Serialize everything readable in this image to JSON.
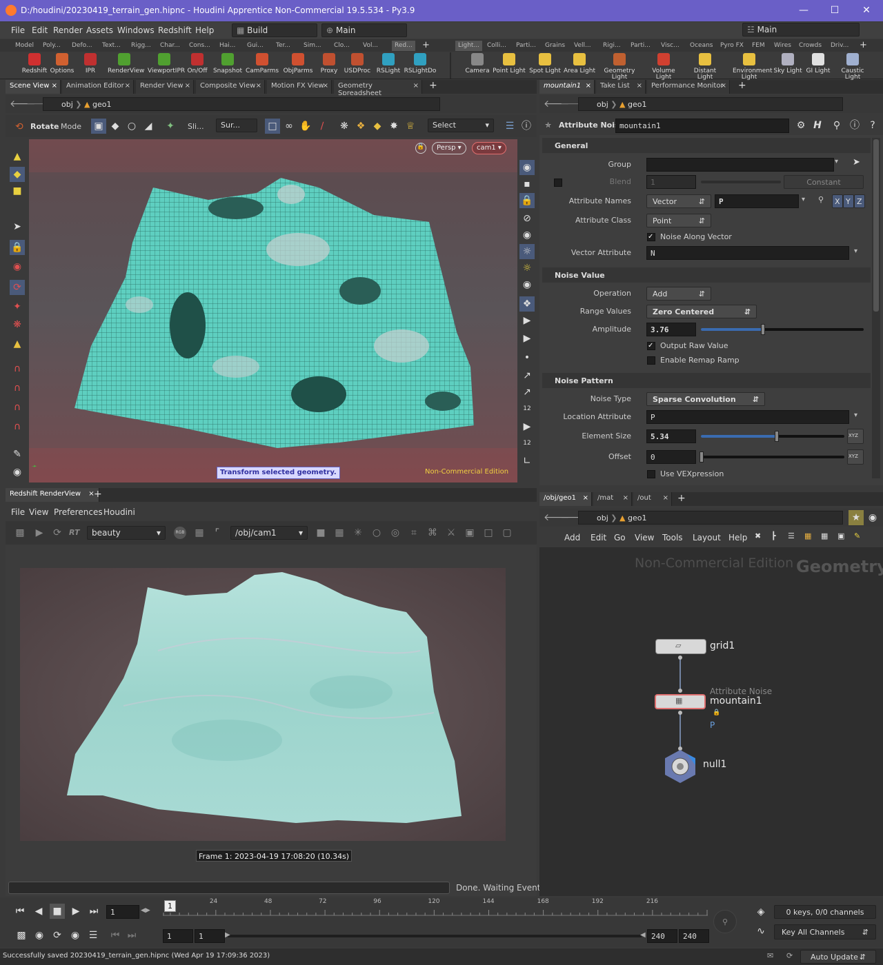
{
  "window": {
    "title": "D:/houdini/20230419_terrain_gen.hipnc - Houdini Apprentice Non-Commercial 19.5.534 - Py3.9",
    "minimize": "—",
    "maximize": "☐",
    "close": "✕"
  },
  "menu": {
    "items": [
      "File",
      "Edit",
      "Render",
      "Assets",
      "Windows",
      "Redshift",
      "Help"
    ],
    "desktop": "Build",
    "network": "Main",
    "right_combo": "Main"
  },
  "shelf_tabs_left": [
    "Model",
    "Poly...",
    "Defo...",
    "Text...",
    "Rigg...",
    "Char...",
    "Cons...",
    "Hai...",
    "Gui...",
    "Ter...",
    "Sim...",
    "Clo...",
    "Vol...",
    "Red..."
  ],
  "shelf_tabs_right": [
    "Light...",
    "Colli...",
    "Parti...",
    "Grains",
    "Vell...",
    "Rigi...",
    "Parti...",
    "Visc...",
    "Oceans",
    "Pyro FX",
    "FEM",
    "Wires",
    "Crowds",
    "Driv..."
  ],
  "tools_left": [
    {
      "label": "Redshift",
      "color": "#d03030"
    },
    {
      "label": "Options",
      "color": "#d06030"
    },
    {
      "label": "IPR",
      "color": "#c03030"
    },
    {
      "label": "RenderView",
      "color": "#50a030"
    },
    {
      "label": "ViewportIPR",
      "color": "#50a030"
    },
    {
      "label": "On/Off",
      "color": "#c03030"
    },
    {
      "label": "Snapshot",
      "color": "#50a030"
    },
    {
      "label": "CamParms",
      "color": "#d05030"
    },
    {
      "label": "ObjParms",
      "color": "#d05030"
    },
    {
      "label": "Proxy",
      "color": "#c05030"
    },
    {
      "label": "USDProc",
      "color": "#c05030"
    },
    {
      "label": "RSLight",
      "color": "#30a0c0"
    },
    {
      "label": "RSLightDo",
      "color": "#30a0c0"
    }
  ],
  "tools_right": [
    {
      "label": "Camera",
      "color": "#888888"
    },
    {
      "label": "Point Light",
      "color": "#e8c040"
    },
    {
      "label": "Spot Light",
      "color": "#e8c040"
    },
    {
      "label": "Area Light",
      "color": "#e8c040"
    },
    {
      "label": "Geometry Light",
      "color": "#c06030"
    },
    {
      "label": "Volume Light",
      "color": "#d04030"
    },
    {
      "label": "Distant Light",
      "color": "#e8c040"
    },
    {
      "label": "Environment Light",
      "color": "#e8c040"
    },
    {
      "label": "Sky Light",
      "color": "#b0b0c0"
    },
    {
      "label": "GI Light",
      "color": "#e0e0e0"
    },
    {
      "label": "Caustic Light",
      "color": "#a0b0d0"
    }
  ],
  "left_tabs": [
    "Scene View",
    "Animation Editor",
    "Render View",
    "Composite View",
    "Motion FX View",
    "Geometry Spreadsheet"
  ],
  "right_tabs": [
    "mountain1",
    "Take List",
    "Performance Monitor"
  ],
  "scene_path": {
    "obj": "obj",
    "geo": "geo1"
  },
  "scene_toolbar": {
    "rotate": "Rotate",
    "mode": "Mode",
    "sli": "Sli...",
    "sur": "Sur...",
    "select": "Select"
  },
  "viewport": {
    "persp": "Persp ▾",
    "cam": "cam1 ▾",
    "status": "Transform selected geometry.",
    "edition": "Non-Commercial Edition"
  },
  "params": {
    "node_type": "Attribute Noise",
    "node_name": "mountain1",
    "general": "General",
    "group_label": "Group",
    "group_value": "",
    "blend_label": "Blend",
    "blend_value": "1",
    "blend_mode": "Constant",
    "attr_names_label": "Attribute Names",
    "attr_names_type": "Vector",
    "attr_names_value": "P",
    "xyz": [
      "X",
      "Y",
      "Z"
    ],
    "attr_class_label": "Attribute Class",
    "attr_class_value": "Point",
    "noise_along_vector": "Noise Along Vector",
    "vector_attr_label": "Vector Attribute",
    "vector_attr_value": "N",
    "noise_value": "Noise Value",
    "operation_label": "Operation",
    "operation_value": "Add",
    "range_label": "Range Values",
    "range_value": "Zero Centered",
    "amplitude_label": "Amplitude",
    "amplitude_value": "3.76",
    "amplitude_level": 0.38,
    "output_raw": "Output Raw Value",
    "enable_remap": "Enable Remap Ramp",
    "noise_pattern": "Noise Pattern",
    "noise_type_label": "Noise Type",
    "noise_type_value": "Sparse Convolution",
    "location_label": "Location Attribute",
    "location_value": "P",
    "element_size_label": "Element Size",
    "element_size_value": "5.34",
    "element_size_level": 0.53,
    "offset_label": "Offset",
    "offset_value": "0",
    "use_vex": "Use VEXpression",
    "xyz_btn": "XYZ"
  },
  "renderview": {
    "tab": "Redshift RenderView",
    "menu": [
      "File",
      "View",
      "Preferences",
      "Houdini"
    ],
    "rt": "RT",
    "aov": "beauty",
    "rgb": "RGB",
    "camera": "/obj/cam1",
    "frame_info": "Frame  1:  2023-04-19  17:08:20  (10.34s)",
    "progress_text": "Done. Waiting Events"
  },
  "network": {
    "tabs": [
      "/obj/geo1",
      "/mat",
      "/out"
    ],
    "path_obj": "obj",
    "path_geo": "geo1",
    "menu": [
      "Add",
      "Edit",
      "Go",
      "View",
      "Tools",
      "Layout",
      "Help"
    ],
    "watermark": "Non-Commercial Edition",
    "context": "Geometry",
    "nodes": {
      "grid": "grid1",
      "noise_type": "Attribute Noise",
      "noise": "mountain1",
      "noise_flag": "P",
      "null": "null1"
    }
  },
  "timeline": {
    "frame": "1",
    "ticks": [
      "24",
      "48",
      "72",
      "96",
      "120",
      "144",
      "168",
      "192",
      "216"
    ],
    "current": "1",
    "start": "1",
    "start2": "1",
    "end": "240",
    "end2": "240",
    "keys": "0 keys, 0/0 channels",
    "key_all": "Key All Channels"
  },
  "status": {
    "message": "Successfully saved 20230419_terrain_gen.hipnc (Wed Apr 19 17:09:36 2023)",
    "auto_update": "Auto Update"
  }
}
